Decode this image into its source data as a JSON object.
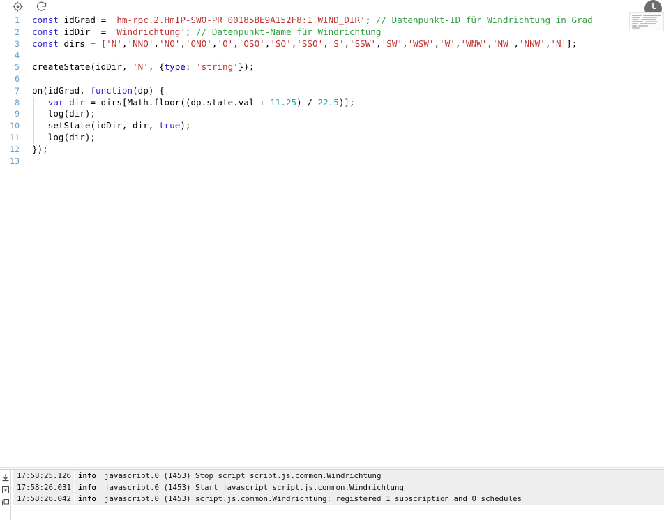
{
  "app": {
    "title": "ioBroker JavaScript Script Editor"
  },
  "toolbar": {
    "icons": [
      {
        "name": "locate-icon",
        "label": "Select / Locate"
      },
      {
        "name": "refresh-icon",
        "label": "Restart script"
      }
    ]
  },
  "editor": {
    "language": "javascript",
    "total_lines": 13,
    "line_numbers": [
      "1",
      "2",
      "3",
      "4",
      "5",
      "6",
      "7",
      "8",
      "9",
      "10",
      "11",
      "12",
      "13"
    ],
    "lines": [
      {
        "number": "1",
        "tokens": [
          {
            "t": "const",
            "c": "kw"
          },
          {
            "t": " idGrad = ",
            "c": "pun"
          },
          {
            "t": "'hm-rpc.2.HmIP-SWO-PR 00185BE9A152F8:1.WIND_DIR'",
            "c": "str"
          },
          {
            "t": "; ",
            "c": "pun"
          },
          {
            "t": "// Datenpunkt-ID für Windrichtung in Grad",
            "c": "cmt"
          }
        ]
      },
      {
        "number": "2",
        "tokens": [
          {
            "t": "const",
            "c": "kw"
          },
          {
            "t": " idDir  = ",
            "c": "pun"
          },
          {
            "t": "'Windrichtung'",
            "c": "str"
          },
          {
            "t": "; ",
            "c": "pun"
          },
          {
            "t": "// Datenpunkt-Name für Windrichtung",
            "c": "cmt"
          }
        ]
      },
      {
        "number": "3",
        "tokens": [
          {
            "t": "const",
            "c": "kw"
          },
          {
            "t": " dirs = [",
            "c": "pun"
          },
          {
            "t": "'N'",
            "c": "str"
          },
          {
            "t": ",",
            "c": "pun"
          },
          {
            "t": "'NNO'",
            "c": "str"
          },
          {
            "t": ",",
            "c": "pun"
          },
          {
            "t": "'NO'",
            "c": "str"
          },
          {
            "t": ",",
            "c": "pun"
          },
          {
            "t": "'ONO'",
            "c": "str"
          },
          {
            "t": ",",
            "c": "pun"
          },
          {
            "t": "'O'",
            "c": "str"
          },
          {
            "t": ",",
            "c": "pun"
          },
          {
            "t": "'OSO'",
            "c": "str"
          },
          {
            "t": ",",
            "c": "pun"
          },
          {
            "t": "'SO'",
            "c": "str"
          },
          {
            "t": ",",
            "c": "pun"
          },
          {
            "t": "'SSO'",
            "c": "str"
          },
          {
            "t": ",",
            "c": "pun"
          },
          {
            "t": "'S'",
            "c": "str"
          },
          {
            "t": ",",
            "c": "pun"
          },
          {
            "t": "'SSW'",
            "c": "str"
          },
          {
            "t": ",",
            "c": "pun"
          },
          {
            "t": "'SW'",
            "c": "str"
          },
          {
            "t": ",",
            "c": "pun"
          },
          {
            "t": "'WSW'",
            "c": "str"
          },
          {
            "t": ",",
            "c": "pun"
          },
          {
            "t": "'W'",
            "c": "str"
          },
          {
            "t": ",",
            "c": "pun"
          },
          {
            "t": "'WNW'",
            "c": "str"
          },
          {
            "t": ",",
            "c": "pun"
          },
          {
            "t": "'NW'",
            "c": "str"
          },
          {
            "t": ",",
            "c": "pun"
          },
          {
            "t": "'NNW'",
            "c": "str"
          },
          {
            "t": ",",
            "c": "pun"
          },
          {
            "t": "'N'",
            "c": "str"
          },
          {
            "t": "];",
            "c": "pun"
          }
        ]
      },
      {
        "number": "4",
        "tokens": []
      },
      {
        "number": "5",
        "tokens": [
          {
            "t": "createState(idDir, ",
            "c": "pun"
          },
          {
            "t": "'N'",
            "c": "str"
          },
          {
            "t": ", {",
            "c": "pun"
          },
          {
            "t": "type",
            "c": "kw2"
          },
          {
            "t": ": ",
            "c": "pun"
          },
          {
            "t": "'string'",
            "c": "str"
          },
          {
            "t": "});",
            "c": "pun"
          }
        ]
      },
      {
        "number": "6",
        "tokens": []
      },
      {
        "number": "7",
        "tokens": [
          {
            "t": "on(idGrad, ",
            "c": "pun"
          },
          {
            "t": "function",
            "c": "kw"
          },
          {
            "t": "(dp) {",
            "c": "pun"
          }
        ]
      },
      {
        "number": "8",
        "tokens": [
          {
            "t": "   ",
            "c": "pun"
          },
          {
            "t": "var",
            "c": "kw"
          },
          {
            "t": " dir = dirs[Math.floor((dp.state.val + ",
            "c": "pun"
          },
          {
            "t": "11.25",
            "c": "num"
          },
          {
            "t": ") / ",
            "c": "pun"
          },
          {
            "t": "22.5",
            "c": "num"
          },
          {
            "t": ")];",
            "c": "pun"
          }
        ]
      },
      {
        "number": "9",
        "tokens": [
          {
            "t": "   log(dir);",
            "c": "pun"
          }
        ]
      },
      {
        "number": "10",
        "tokens": [
          {
            "t": "   setState(idDir, dir, ",
            "c": "pun"
          },
          {
            "t": "true",
            "c": "kw"
          },
          {
            "t": ");",
            "c": "pun"
          }
        ]
      },
      {
        "number": "11",
        "tokens": [
          {
            "t": "   log(dir);",
            "c": "pun"
          }
        ]
      },
      {
        "number": "12",
        "tokens": [
          {
            "t": "});",
            "c": "pun"
          }
        ]
      },
      {
        "number": "13",
        "tokens": []
      }
    ]
  },
  "log": {
    "actions": [
      {
        "name": "scroll-to-bottom-icon",
        "label": "Scroll to bottom"
      },
      {
        "name": "clear-log-icon",
        "label": "Clear log"
      },
      {
        "name": "copy-log-icon",
        "label": "Copy log"
      }
    ],
    "rows": [
      {
        "timestamp": "17:58:25.126",
        "severity": "info",
        "message": "javascript.0 (1453) Stop script script.js.common.Windrichtung"
      },
      {
        "timestamp": "17:58:26.031",
        "severity": "info",
        "message": "javascript.0 (1453) Start javascript script.js.common.Windrichtung"
      },
      {
        "timestamp": "17:58:26.042",
        "severity": "info",
        "message": "javascript.0 (1453) script.js.common.Windrichtung: registered 1 subscription and 0 schedules"
      }
    ]
  },
  "overlay": {
    "name": "clock-badge-icon",
    "label": "recent-activity-badge"
  },
  "colors": {
    "keyword": "#2b1fd6",
    "string": "#c03030",
    "comment": "#2f9e41",
    "number": "#19a39b",
    "gutter": "#6a9ec4",
    "log_row_bg": "#eeeeee",
    "background": "#ffffff"
  }
}
